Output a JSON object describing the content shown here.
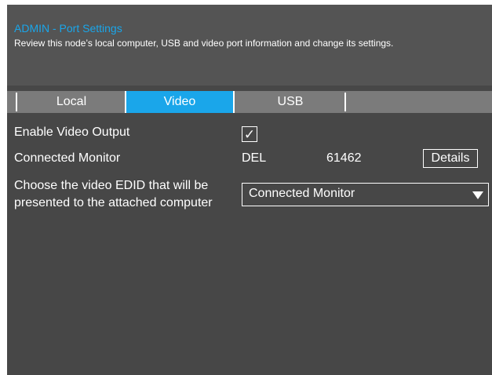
{
  "header": {
    "title": "ADMIN - Port Settings",
    "subtitle": "Review this node’s local computer, USB and video port information and change its settings."
  },
  "tabs": [
    {
      "label": "Local",
      "selected": false
    },
    {
      "label": "Video",
      "selected": true
    },
    {
      "label": "USB",
      "selected": false
    }
  ],
  "video": {
    "enable_label": "Enable Video Output",
    "enable_checked": true,
    "checkmark": "✓",
    "monitor_label": "Connected Monitor",
    "monitor_vendor": "DEL",
    "monitor_id": "61462",
    "details_label": "Details",
    "edid_label_line1": "Choose the video EDID that will be",
    "edid_label_line2": "presented to the attached computer",
    "edid_selected": "Connected Monitor"
  },
  "colors": {
    "accent": "#1aa6ea",
    "panel": "#474747",
    "header": "#545454",
    "tabbar": "#7b7b7b"
  }
}
